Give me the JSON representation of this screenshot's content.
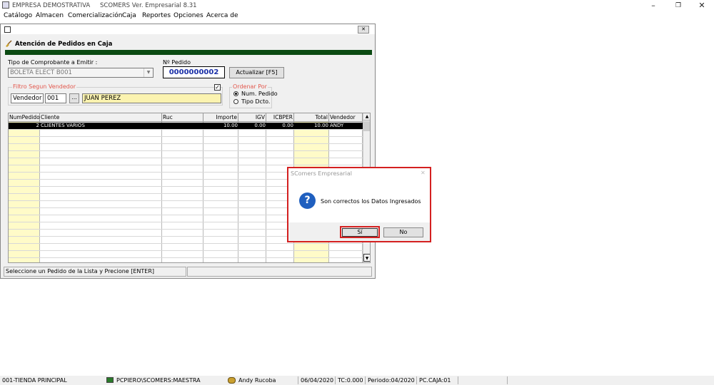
{
  "titlebar": {
    "company": "EMPRESA DEMOSTRATIVA",
    "app_title": "SCOMERS Ver. Empresarial  8.31",
    "minimize_glyph": "–",
    "restore_glyph": "❐",
    "close_glyph": "✕"
  },
  "menu": [
    {
      "label": "Catálogo"
    },
    {
      "label": "Almacen"
    },
    {
      "label": "Comercialización"
    },
    {
      "label": "Caja"
    },
    {
      "label": "Reportes"
    },
    {
      "label": "Opciones"
    },
    {
      "label": "Acerca de"
    }
  ],
  "order_window": {
    "close_glyph": "✕",
    "header_title": "Atención de Pedidos en Caja",
    "comprobante_label": "Tipo de Comprobante a Emitir :",
    "comprobante_value": "BOLETA ELECT B001",
    "pedido_label": "Nº Pedido",
    "pedido_value": "0000000002",
    "actualizar_label": "Actualizar  [F5]",
    "filtro_label": "Filtro Segun Vendedor",
    "filtro_checked": true,
    "vendedor_label": "Vendedor",
    "vendedor_code": "001",
    "browse_label": "...",
    "vendedor_name": "JUAN PEREZ",
    "ordenar_label": "Ordenar Por",
    "radio_num": "Num. Pedido",
    "radio_tipo": "Tipo Dcto.",
    "selected_order": "Num. Pedido",
    "status_text": "Seleccione un Pedido de la Lista y Precione [ENTER]"
  },
  "table": {
    "headers": [
      "NumPedido",
      "Cliente",
      "Ruc",
      "Importe",
      "IGV",
      "ICBPER",
      "Total",
      "Vendedor"
    ],
    "rows": [
      [
        "2",
        "CLIENTES VARIOS",
        "",
        "10.00",
        "0.00",
        "0.00",
        "10.00",
        "ANDY"
      ]
    ],
    "scroll_up": "▲",
    "scroll_down": "▼",
    "selected_row_color": "#000000",
    "highlight_col_color": "#fffbc8"
  },
  "dialog": {
    "title": "SComers Empresarial",
    "close_glyph": "✕",
    "icon_glyph": "?",
    "message": "Son correctos los Datos Ingresados",
    "yes_label": "Sí",
    "no_label": "No",
    "highlight_color": "#e02020"
  },
  "statusbar": {
    "store": "001-TIENDA PRINCIPAL",
    "db": "PCPIERO\\SCOMERS:MAESTRA",
    "user": "Andy Rucoba",
    "date": "06/04/2020",
    "tc": "TC:0.000",
    "period": "Periodo:04/2020",
    "pc": "PC.CAJA:01"
  }
}
